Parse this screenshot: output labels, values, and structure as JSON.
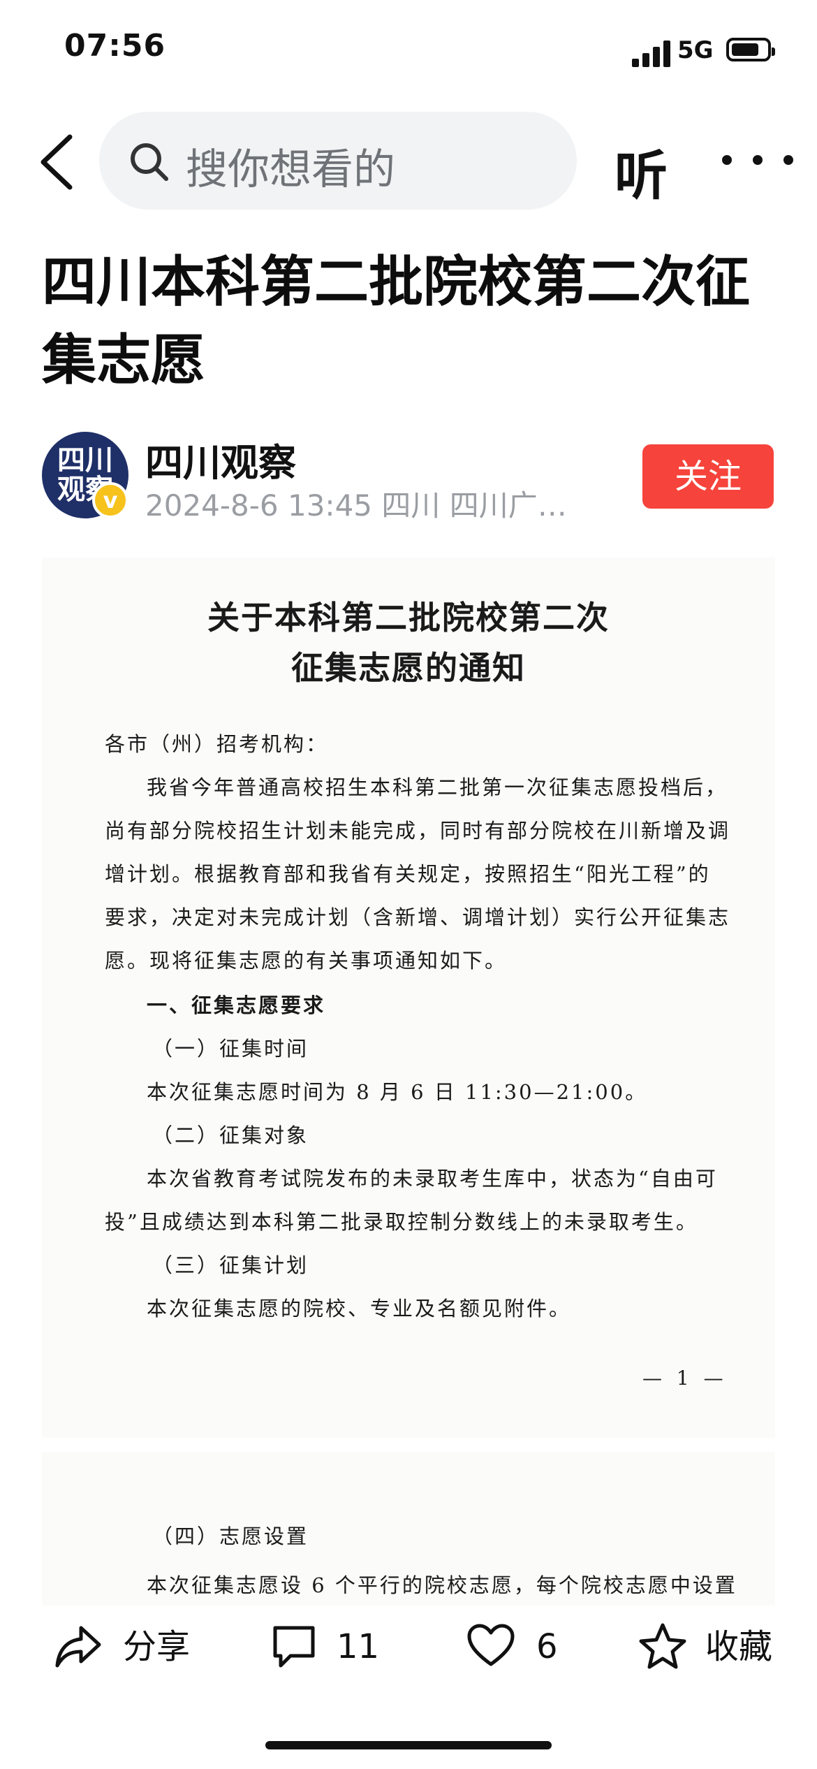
{
  "status_bar": {
    "time": "07:56",
    "network": "5G"
  },
  "nav": {
    "search_placeholder": "搜你想看的",
    "listen_label": "听"
  },
  "article": {
    "title": "四川本科第二批院校第二次征集志愿",
    "author": "四川观察",
    "avatar_text": "四川观察",
    "meta": "2024-8-6 13:45 四川 四川广…",
    "follow_label": "关注"
  },
  "document": {
    "title_line1": "关于本科第二批院校第二次",
    "title_line2": "征集志愿的通知",
    "lines": [
      "各市（州）招考机构：",
      "我省今年普通高校招生本科第二批第一次征集志愿投档后，",
      "尚有部分院校招生计划未能完成，同时有部分院校在川新增及调",
      "增计划。根据教育部和我省有关规定，按照招生“阳光工程”的",
      "要求，决定对未完成计划（含新增、调增计划）实行公开征集志",
      "愿。现将征集志愿的有关事项通知如下。",
      "一、征集志愿要求",
      "（一）征集时间",
      "本次征集志愿时间为 8 月 6 日 11:30—21:00。",
      "（二）征集对象",
      "本次省教育考试院发布的未录取考生库中，状态为“自由可",
      "投”且成绩达到本科第二批录取控制分数线上的未录取考生。",
      "（三）征集计划",
      "本次征集志愿的院校、专业及名额见附件。"
    ],
    "page_number": "— 1 —",
    "page2_lines": [
      "（四）志愿设置",
      "本次征集志愿设 6 个平行的院校志愿，每个院校志愿中设置"
    ]
  },
  "bottom_bar": {
    "share_label": "分享",
    "comment_count": "11",
    "like_count": "6",
    "favorite_label": "收藏"
  }
}
